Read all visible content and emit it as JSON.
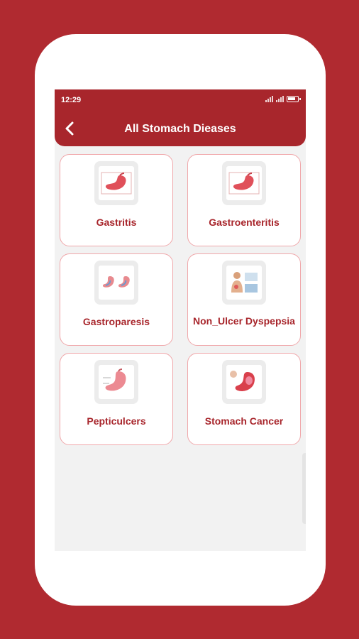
{
  "status_bar": {
    "time": "12:29"
  },
  "app_bar": {
    "title": "All Stomach Dieases",
    "back_icon": "chevron-left-icon"
  },
  "colors": {
    "background": "#b02a30",
    "app_bar": "#a8262c",
    "accent_text": "#a8262c",
    "card_border": "#f0a7aa"
  },
  "diseases": [
    {
      "label": "Gastritis",
      "image": "stomach-illustration"
    },
    {
      "label": "Gastroenteritis",
      "image": "stomach-illustration"
    },
    {
      "label": "Gastroparesis",
      "image": "stomach-comparison-illustration"
    },
    {
      "label": "Non_Ulcer Dyspepsia",
      "image": "patient-illustration"
    },
    {
      "label": "Pepticulcers",
      "image": "stomach-ulcer-illustration"
    },
    {
      "label": "Stomach Cancer",
      "image": "stomach-cancer-illustration"
    }
  ]
}
